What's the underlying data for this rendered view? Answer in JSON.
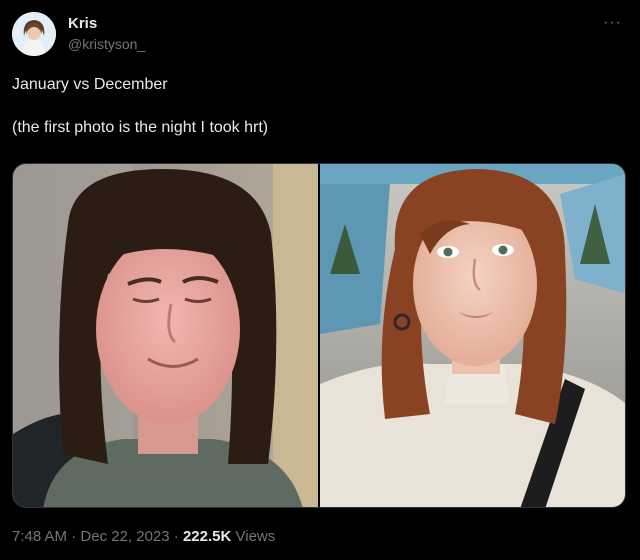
{
  "author": {
    "display_name": "Kris",
    "handle": "@kristyson_",
    "avatar_icon": "profile-avatar"
  },
  "more_icon": "more-horizontal-icon",
  "tweet": {
    "line1": "January vs December",
    "line2": "(the first photo is the night I took hrt)"
  },
  "media": {
    "photos": [
      {
        "name": "january-photo"
      },
      {
        "name": "december-photo"
      }
    ]
  },
  "meta": {
    "time": "7:48 AM",
    "separator": "·",
    "date": "Dec 22, 2023",
    "views_count": "222.5K",
    "views_label": "Views"
  },
  "colors": {
    "background": "#000000",
    "primary_text": "#e7e9ea",
    "secondary_text": "#71767b",
    "border": "#2f3336"
  }
}
